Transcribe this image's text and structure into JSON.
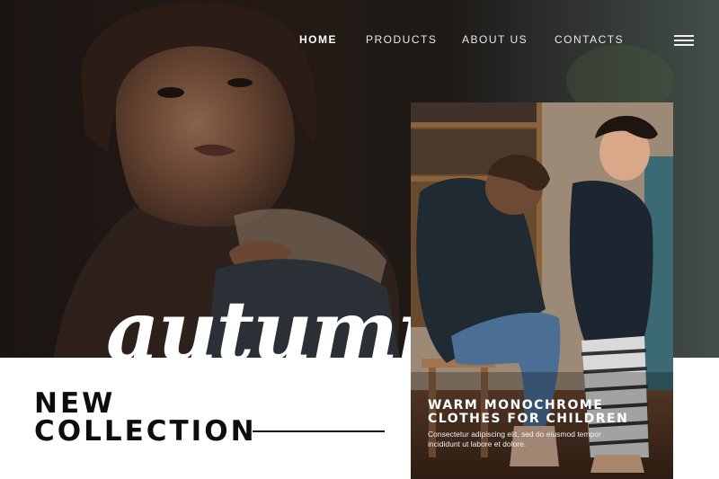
{
  "nav": {
    "items": [
      {
        "label": "HOME",
        "active": true
      },
      {
        "label": "PRODUCTS",
        "active": false
      },
      {
        "label": "ABOUT US",
        "active": false
      },
      {
        "label": "CONTACTS",
        "active": false
      }
    ],
    "menu_icon": "hamburger-menu-icon"
  },
  "hero": {
    "script_word": "autumn",
    "headline_line1": "NEW",
    "headline_line2": "COLLECTION"
  },
  "card": {
    "title_line1": "WARM MONOCHROME",
    "title_line2": "CLOTHES FOR CHILDREN",
    "text": "Consectetur adipiscing elit, sed do eiusmod tempor incididunt ut labore et dolore."
  },
  "colors": {
    "background": "#ffffff",
    "hero_dark": "#1e1713",
    "text_dark": "#0d0d0d",
    "text_light": "#ffffff"
  }
}
